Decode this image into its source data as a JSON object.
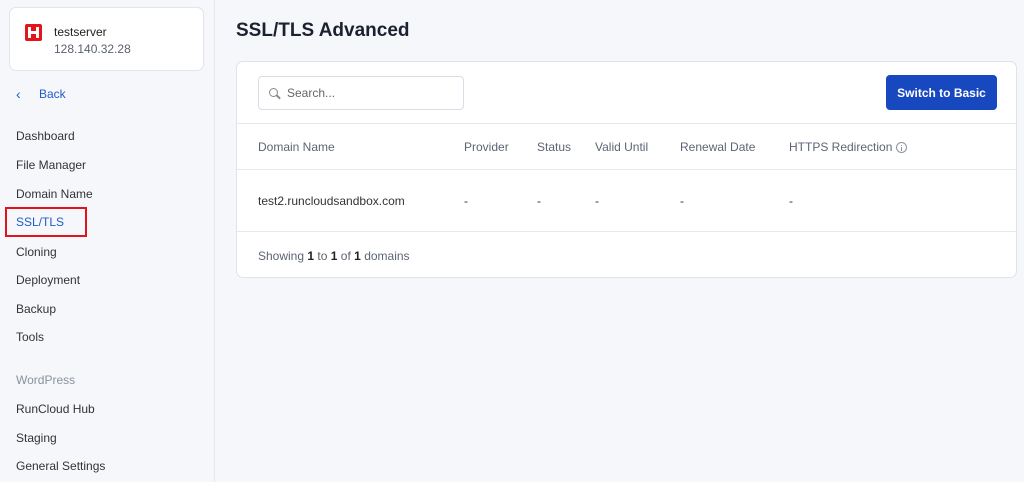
{
  "server": {
    "name": "testserver",
    "ip": "128.140.32.28"
  },
  "sidebar": {
    "back_label": "Back",
    "items": [
      {
        "label": "Dashboard"
      },
      {
        "label": "File Manager"
      },
      {
        "label": "Domain Name"
      },
      {
        "label": "SSL/TLS",
        "active": true
      },
      {
        "label": "Cloning"
      },
      {
        "label": "Deployment"
      },
      {
        "label": "Backup"
      },
      {
        "label": "Tools"
      }
    ],
    "wordpress_section": "WordPress",
    "wordpress_items": [
      {
        "label": "RunCloud Hub"
      },
      {
        "label": "Staging"
      },
      {
        "label": "General Settings"
      }
    ]
  },
  "main": {
    "title": "SSL/TLS Advanced",
    "search_placeholder": "Search...",
    "switch_button": "Switch to Basic",
    "columns": [
      "Domain Name",
      "Provider",
      "Status",
      "Valid Until",
      "Renewal Date",
      "HTTPS Redirection"
    ],
    "rows": [
      {
        "domain": "test2.runcloudsandbox.com",
        "provider": "-",
        "status": "-",
        "valid_until": "-",
        "renewal_date": "-",
        "https_redirection": "-"
      }
    ],
    "footer": {
      "prefix": "Showing",
      "from": "1",
      "to_word": "to",
      "to": "1",
      "of_word": "of",
      "total": "1",
      "suffix": "domains"
    }
  },
  "colors": {
    "accent": "#1748c0",
    "link": "#1f5cc9",
    "highlight": "#e1141b",
    "logo": "#e3151b"
  }
}
